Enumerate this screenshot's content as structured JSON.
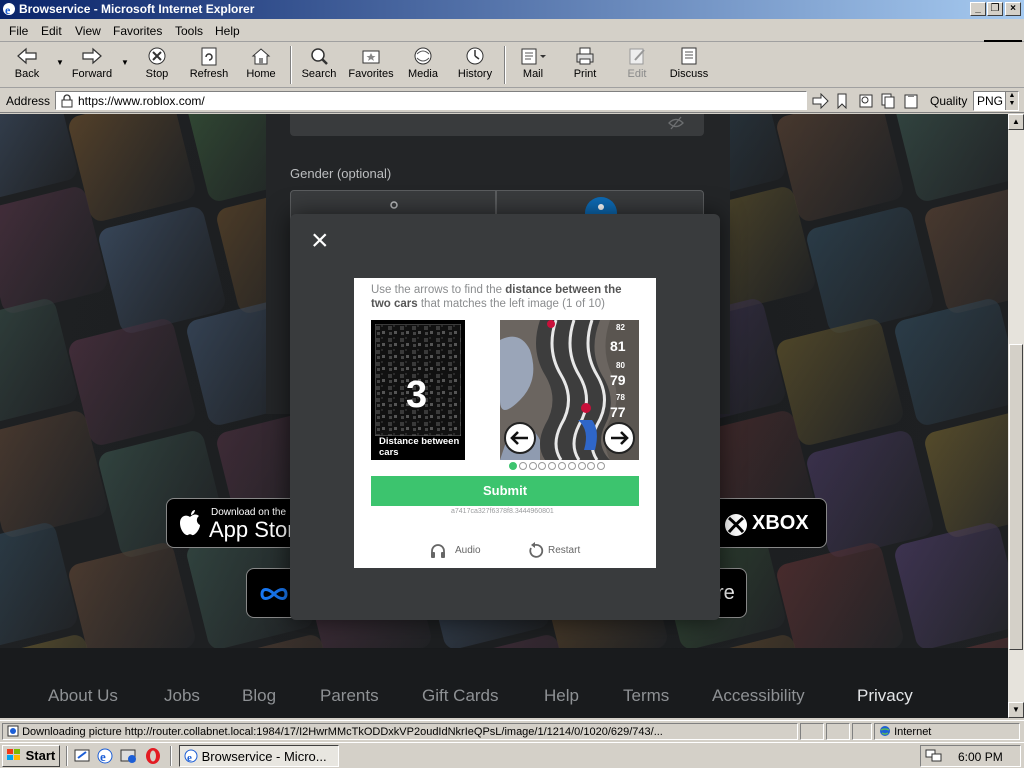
{
  "window": {
    "title": "Browservice - Microsoft Internet Explorer"
  },
  "menu": [
    "File",
    "Edit",
    "View",
    "Favorites",
    "Tools",
    "Help"
  ],
  "toolbar": {
    "back": "Back",
    "forward": "Forward",
    "stop": "Stop",
    "refresh": "Refresh",
    "home": "Home",
    "search": "Search",
    "favorites": "Favorites",
    "media": "Media",
    "history": "History",
    "mail": "Mail",
    "print": "Print",
    "edit": "Edit",
    "discuss": "Discuss"
  },
  "address": {
    "label": "Address",
    "url": "https://www.roblox.com/",
    "quality_label": "Quality",
    "quality_value": "PNG"
  },
  "page": {
    "gender_label": "Gender (optional)",
    "store_badges": {
      "appstore_small": "Download on the",
      "appstore_big": "App Stor",
      "xbox": "XBOX",
      "store_suffix": "re"
    },
    "footer_links": [
      "About Us",
      "Jobs",
      "Blog",
      "Parents",
      "Gift Cards",
      "Help",
      "Terms",
      "Accessibility",
      "Privacy"
    ]
  },
  "modal": {
    "close": "×",
    "instr_pre": "Use the arrows to find the ",
    "instr_bold1": "distance between the two cars",
    "instr_post": " that matches the left image (1 of 10)",
    "ref_number": "3",
    "ref_caption": "Distance between cars",
    "road_numbers": [
      "82",
      "81",
      "80",
      "79",
      "78",
      "77"
    ],
    "pages_total": 10,
    "pages_active": 1,
    "submit": "Submit",
    "token": "a7417ca327f6378f8.3444960801",
    "audio": "Audio",
    "restart": "Restart",
    "accent": "#3cc46e"
  },
  "status": {
    "text": "Downloading picture http://router.collabnet.local:1984/17/I2HwrMMcTkODDxkVP2oudIdNkrIeQPsL/image/1/1214/0/1020/629/743/...",
    "zone": "Internet"
  },
  "taskbar": {
    "start": "Start",
    "task": "Browservice - Micro...",
    "clock": "6:00 PM"
  }
}
